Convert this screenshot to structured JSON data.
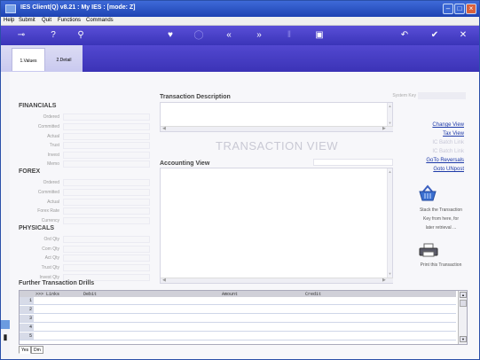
{
  "window": {
    "title": "IES Client(Q) v8.21 : My IES :     [mode: Z]"
  },
  "menu": [
    "Help",
    "Submit",
    "Quit",
    "Functions",
    "Commands"
  ],
  "toolbar": {
    "key_icon": "⊸",
    "help_icon": "?",
    "search_icon": "⚲",
    "favourite_icon": "♥",
    "record_icon": "◯",
    "prev_icon": "«",
    "next_icon": "»",
    "pause_icon": "‖",
    "save_icon": "▣",
    "undo_icon": "↶",
    "ok_icon": "✔",
    "close_icon": "✕"
  },
  "tabs": [
    {
      "label": "1.Values"
    },
    {
      "label": "2.Detail"
    }
  ],
  "system_key_label": "System Key",
  "financials": {
    "title": "FINANCIALS",
    "fields": [
      "Ordered",
      "Committed",
      "Actual",
      "Trust",
      "Invest",
      "Memo"
    ]
  },
  "forex": {
    "title": "FOREX",
    "fields": [
      "Ordered",
      "Committed",
      "Actual",
      "Forex Rate",
      "Currency"
    ]
  },
  "physicals": {
    "title": "PHYSICALS",
    "fields": [
      "Ord Qty",
      "Com Qty",
      "Act Qty",
      "Trust Qty",
      "Invest Qty"
    ]
  },
  "transaction_description": {
    "title": "Transaction Description"
  },
  "watermark": "TRANSACTION VIEW",
  "accounting_view": {
    "title": "Accounting View"
  },
  "right_links": [
    {
      "label": "Change View",
      "enabled": true
    },
    {
      "label": "Tax View",
      "enabled": true
    },
    {
      "label": "IC Batch Link",
      "enabled": false
    },
    {
      "label": "IC Batch Link",
      "enabled": false
    },
    {
      "label": "GoTo Reversals",
      "enabled": true
    },
    {
      "label": "Goto UNpost",
      "enabled": true
    }
  ],
  "stack_text": [
    "Stack the Transaction",
    "Key from here, for",
    "later retrieval ..."
  ],
  "print_text": "Print this Transaction",
  "drills": {
    "title": "Further Transaction Drills",
    "columns": [
      ">>> Links",
      "Debit",
      "Amount",
      "Credit"
    ],
    "rows": [
      "1",
      "2",
      "3",
      "4",
      "5"
    ]
  },
  "bottom_tabs": [
    "Yes",
    "Dm"
  ]
}
